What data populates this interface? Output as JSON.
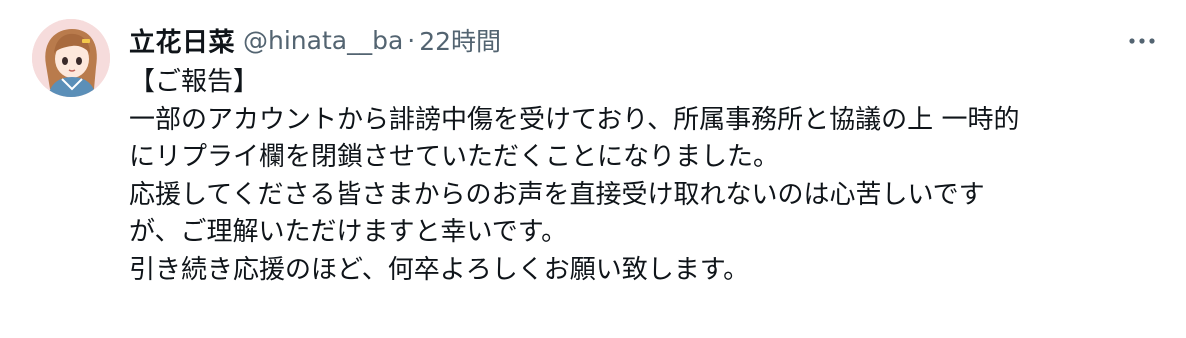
{
  "tweet": {
    "author": {
      "display_name": "立花日菜",
      "handle": "@hinata__ba",
      "separator": "·",
      "time": "22時間",
      "avatar_icon": "avatar-illustration"
    },
    "more_icon": "more-dots-icon",
    "lines": [
      "【ご報告】",
      "一部のアカウントから誹謗中傷を受けており、所属事務所と協議の上 一時的",
      "にリプライ欄を閉鎖させていただくことになりました。",
      "応援してくださる皆さまからのお声を直接受け取れないのは心苦しいです",
      "が、ご理解いただけますと幸いです。",
      "引き続き応援のほど、何卒よろしくお願い致します。"
    ]
  },
  "colors": {
    "text_primary": "#0f1419",
    "text_secondary": "#536471",
    "avatar_bg": "#f6dcdc"
  }
}
